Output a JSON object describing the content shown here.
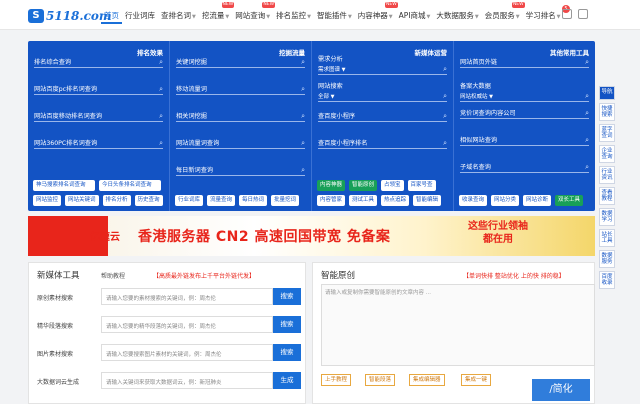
{
  "logo": {
    "mark": "S",
    "text": "5118.com"
  },
  "nav": [
    {
      "label": "首页",
      "active": true,
      "tag": ""
    },
    {
      "label": "行业词库",
      "tag": ""
    },
    {
      "label": "查排名词",
      "tag": "",
      "caret": true
    },
    {
      "label": "挖流量",
      "tag": "NEW",
      "caret": true
    },
    {
      "label": "网站查询",
      "tag": "NEW",
      "caret": true
    },
    {
      "label": "排名监控",
      "tag": "",
      "caret": true
    },
    {
      "label": "智能插件",
      "tag": "",
      "caret": true
    },
    {
      "label": "内容神器",
      "tag": "NEW",
      "caret": true
    },
    {
      "label": "API商城",
      "tag": "",
      "caret": true
    },
    {
      "label": "大数据服务",
      "tag": "",
      "caret": true
    },
    {
      "label": "会员服务",
      "tag": "NEW",
      "caret": true
    },
    {
      "label": "学习排名",
      "tag": "",
      "caret": true
    }
  ],
  "notify_count": "5",
  "cols": [
    {
      "title": "排名效果",
      "rows": [
        "排名综合查询",
        "网站百度pc排名词查询",
        "网站百度移动排名词查询",
        "网站360PC排名词查询"
      ],
      "btns": [
        "神马搜索排名词查询",
        "今日头条排名词查询",
        "网站监控",
        "网站关键词",
        "排名分析",
        "历史查询"
      ]
    },
    {
      "title": "挖掘流量",
      "rows": [
        "关键词挖掘",
        "移动流量词",
        "相关词挖掘",
        "网站流量词查询",
        "每日新词查询"
      ],
      "btns": [
        "行业词库",
        "流量查询",
        "每日热词",
        "批量挖词"
      ]
    },
    {
      "title": "新媒体运营",
      "rows": [
        "需求分析",
        "需求图谱",
        "网站搜索",
        "全部",
        "查百度小程序",
        "查百度小程序排名"
      ],
      "btns": [
        "内容神器",
        "智能原创",
        "占领宝",
        "百家号查",
        "内容管家",
        "测试工具",
        "热点追踪",
        "智能编辑"
      ]
    },
    {
      "title": "其他常用工具",
      "rows": [
        "网站首页外链",
        "备案大数据",
        "网站权威站",
        "竞价词查询内容公司",
        "相似网站查询",
        "子域名查询"
      ],
      "btns": [
        "收录查询",
        "网站分类",
        "网站诊断",
        "双长工具"
      ]
    }
  ],
  "side_tabs": [
    "导航",
    "快捷搜索",
    "蓝字查词",
    "企业查询",
    "行业资讯",
    "查看教程",
    "数据学习",
    "站长工具",
    "数据服务",
    "百度收录"
  ],
  "banner": {
    "brand": "亿速云",
    "headline": "香港服务器 CN2 高速回国带宽 免备案",
    "right": "这些行业领袖\n都在用"
  },
  "media_panel": {
    "title": "新媒体工具",
    "help": "帮助教程",
    "notice": "【高质最外链发布上千平台外链代发】",
    "fields": [
      {
        "label": "原创素材搜索",
        "placeholder": "请输入您要的素材搜索的关键词，例：周杰伦",
        "button": "搜索"
      },
      {
        "label": "精华段落搜索",
        "placeholder": "请输入您要的精华段落的关键词，例：周杰伦",
        "button": "搜索"
      },
      {
        "label": "图片素材搜索",
        "placeholder": "请输入您要搜索图片素材的关键词，例：周杰伦",
        "button": "搜索"
      },
      {
        "label": "大数据词云生成",
        "placeholder": "请输入关键词来获取大数据词云，例：新冠肺炎",
        "button": "生成"
      }
    ]
  },
  "ai_panel": {
    "title": "智能原创",
    "notice": "【单词快排 整站优化 上的快 排的稳】",
    "textarea_placeholder": "请输入或复制你需要智能原创的文章内容 ...",
    "buttons": [
      "上手教程",
      "智能段落",
      "集成编辑器",
      "集成一键"
    ],
    "watermark": "/简化"
  }
}
